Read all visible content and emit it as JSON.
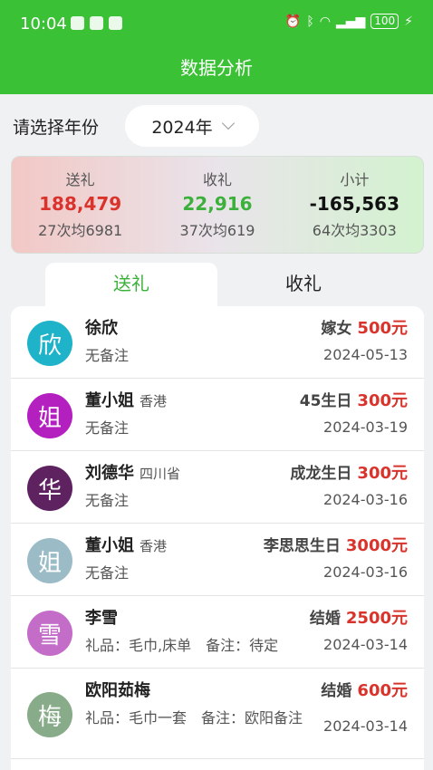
{
  "status": {
    "time": "10:04",
    "battery": "100"
  },
  "appbar": {
    "title": "数据分析"
  },
  "year": {
    "label": "请选择年份",
    "selected": "2024年"
  },
  "summary": [
    {
      "label": "送礼",
      "value": "188,479",
      "sub": "27次均6981",
      "color": "#d9332c"
    },
    {
      "label": "收礼",
      "value": "22,916",
      "sub": "37次均619",
      "color": "#3bb03a"
    },
    {
      "label": "小计",
      "value": "-165,563",
      "sub": "64次均3303",
      "color": "#111111"
    }
  ],
  "tabs": {
    "active": "送礼",
    "inactive": "收礼"
  },
  "records": [
    {
      "avatar": "欣",
      "avatar_color": "#1fb3c9",
      "name": "徐欣",
      "place": "",
      "event": "嫁女",
      "amount": "500元",
      "note": "无备注",
      "date": "2024-05-13"
    },
    {
      "avatar": "姐",
      "avatar_color": "#b41fc0",
      "name": "董小姐",
      "place": "香港",
      "event": "45生日",
      "amount": "300元",
      "note": "无备注",
      "date": "2024-03-19"
    },
    {
      "avatar": "华",
      "avatar_color": "#5e2260",
      "name": "刘德华",
      "place": "四川省",
      "event": "成龙生日",
      "amount": "300元",
      "note": "无备注",
      "date": "2024-03-16"
    },
    {
      "avatar": "姐",
      "avatar_color": "#9bbcc7",
      "name": "董小姐",
      "place": "香港",
      "event": "李思思生日",
      "amount": "3000元",
      "note": "无备注",
      "date": "2024-03-16"
    },
    {
      "avatar": "雪",
      "avatar_color": "#c36cc8",
      "name": "李雪",
      "place": "",
      "event": "结婚",
      "amount": "2500元",
      "note": "礼品：毛巾,床单　备注：待定",
      "date": "2024-03-14"
    },
    {
      "avatar": "梅",
      "avatar_color": "#88ab8a",
      "name": "欧阳茹梅",
      "place": "",
      "event": "结婚",
      "amount": "600元",
      "note": "礼品：毛巾一套　备注：欧阳备注",
      "date": "2024-03-14"
    }
  ]
}
